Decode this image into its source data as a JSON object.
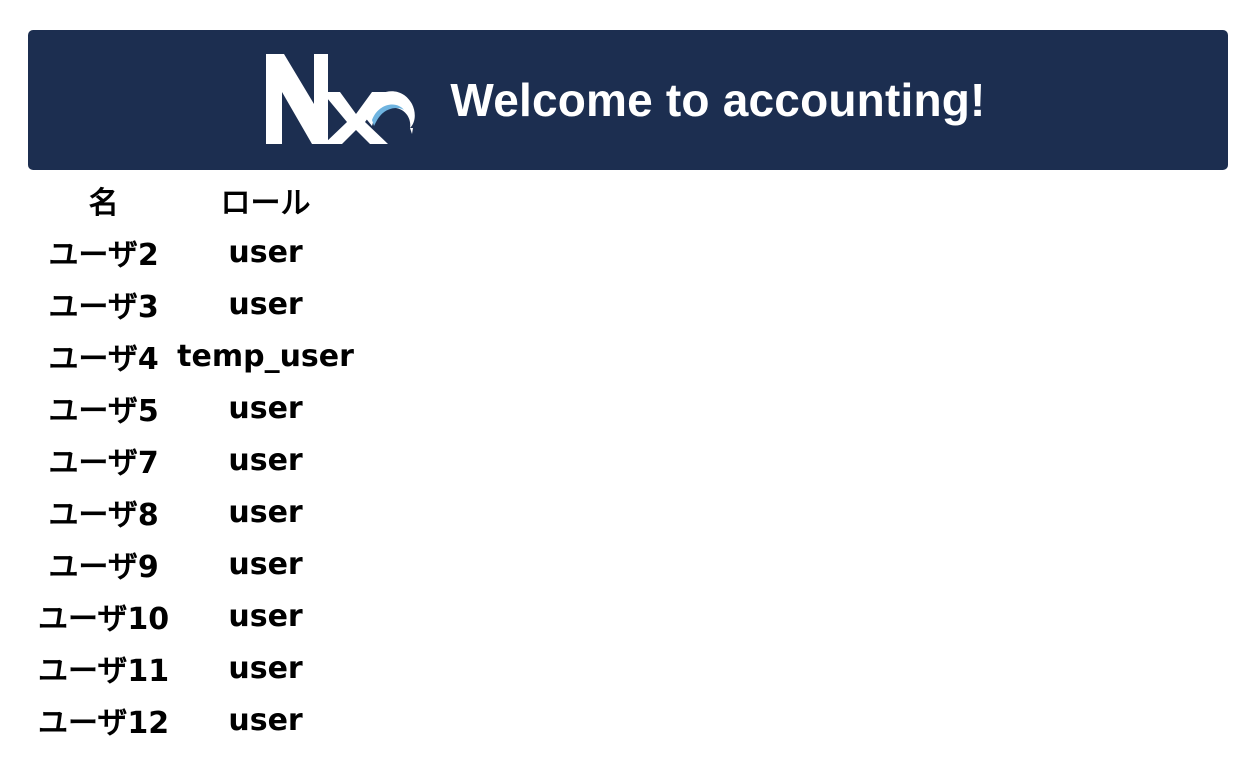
{
  "header": {
    "title": "Welcome to accounting!",
    "logo_icon": "nx-logo-icon",
    "background_color": "#1c2e50",
    "logo_accent_color": "#6fb4e0"
  },
  "table": {
    "columns": [
      "名",
      "ロール"
    ],
    "rows": [
      {
        "name": "ユーザ2",
        "role": "user"
      },
      {
        "name": "ユーザ3",
        "role": "user"
      },
      {
        "name": "ユーザ4",
        "role": "temp_user"
      },
      {
        "name": "ユーザ5",
        "role": "user"
      },
      {
        "name": "ユーザ7",
        "role": "user"
      },
      {
        "name": "ユーザ8",
        "role": "user"
      },
      {
        "name": "ユーザ9",
        "role": "user"
      },
      {
        "name": "ユーザ10",
        "role": "user"
      },
      {
        "name": "ユーザ11",
        "role": "user"
      },
      {
        "name": "ユーザ12",
        "role": "user"
      }
    ]
  }
}
